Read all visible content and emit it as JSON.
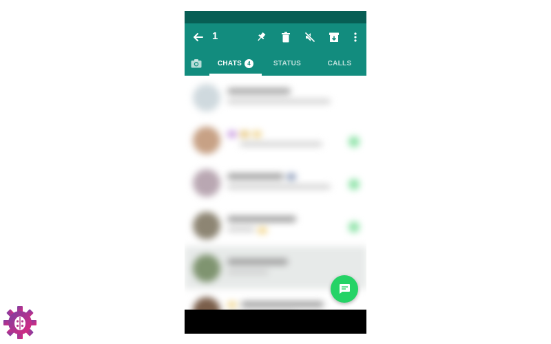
{
  "app_bar": {
    "back_icon": "arrow-back-icon",
    "selection_count": "1",
    "actions": [
      "pin-icon",
      "delete-icon",
      "mute-icon",
      "archive-icon",
      "more-vert-icon"
    ]
  },
  "tabs": {
    "camera_icon": "camera-icon",
    "chats_label": "CHATS",
    "chats_badge": "4",
    "status_label": "STATUS",
    "calls_label": "CALLS"
  },
  "fab": {
    "icon": "new-chat-icon"
  },
  "colors": {
    "primary": "#128C7E",
    "primary_dark": "#075E54",
    "accent": "#25D366",
    "logo_start": "#7b3fa3",
    "logo_end": "#e0287c"
  }
}
